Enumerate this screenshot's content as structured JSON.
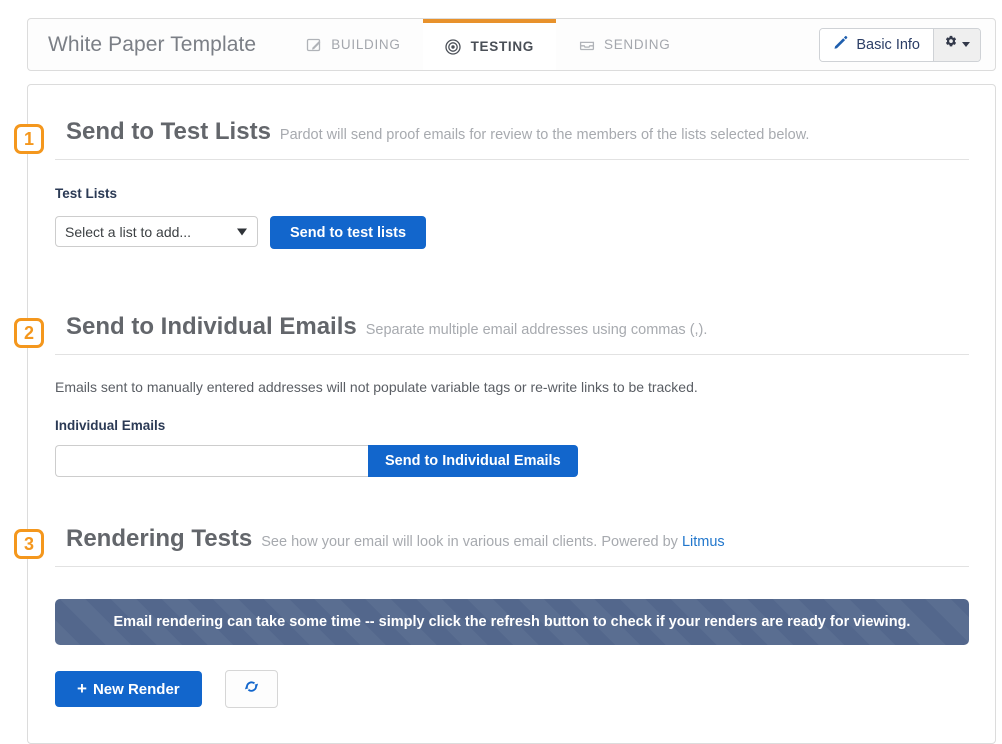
{
  "header": {
    "doc_title": "White Paper Template",
    "tabs": [
      {
        "label": "BUILDING",
        "icon": "pencil-square-icon",
        "active": false
      },
      {
        "label": "TESTING",
        "icon": "bullseye-icon",
        "active": true
      },
      {
        "label": "SENDING",
        "icon": "inbox-icon",
        "active": false
      }
    ],
    "basic_info_label": "Basic Info",
    "gear_icon": "gear-icon",
    "accent_color": "#e8922c"
  },
  "sections": {
    "test_lists": {
      "badge": "1",
      "title": "Send to Test Lists",
      "subtitle": "Pardot will send proof emails for review to the members of the lists selected below.",
      "field_label": "Test Lists",
      "select_value": "Select a list to add...",
      "send_button": "Send to test lists"
    },
    "individual_emails": {
      "badge": "2",
      "title": "Send to Individual Emails",
      "subtitle": "Separate multiple email addresses using commas (,).",
      "note": "Emails sent to manually entered addresses will not populate variable tags or re-write links to be tracked.",
      "field_label": "Individual Emails",
      "input_value": "",
      "input_placeholder": "",
      "send_button": "Send to Individual Emails"
    },
    "rendering_tests": {
      "badge": "3",
      "title": "Rendering Tests",
      "subtitle_prefix": "See how your email will look in various email clients. Powered by ",
      "subtitle_link": "Litmus",
      "alert_message": "Email rendering can take some time -- simply click the refresh button to check if your renders are ready for viewing.",
      "new_render_label": "New Render",
      "new_render_plus": "+",
      "refresh_icon": "refresh-icon",
      "alert_color": "#53678c"
    }
  },
  "colors": {
    "primary_blue": "#1266cc",
    "badge_orange": "#f4971d",
    "link_blue": "#2277cc"
  }
}
